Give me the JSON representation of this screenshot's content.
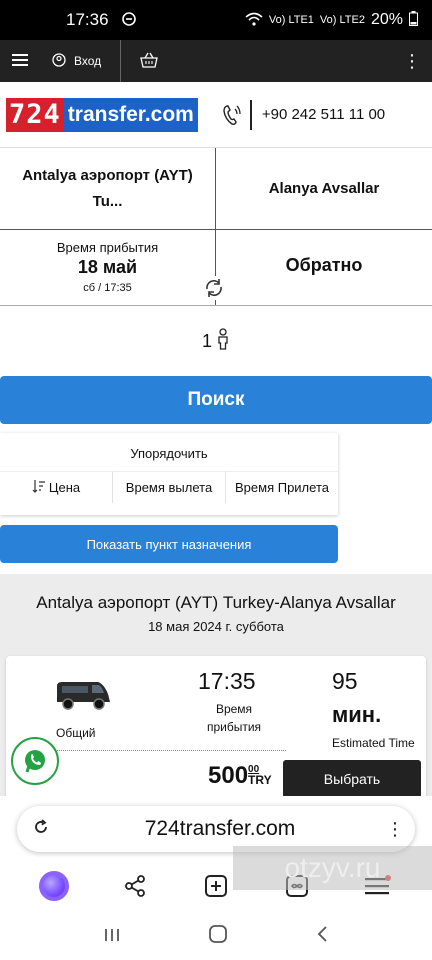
{
  "status_bar": {
    "time": "17:36",
    "network1": "Vo) LTE1",
    "network2": "Vo) LTE2",
    "battery": "20%"
  },
  "top_nav": {
    "login_label": "Вход"
  },
  "header": {
    "logo_number": "724",
    "logo_text": "transfer.com",
    "phone": "+90 242 511 11 00"
  },
  "route": {
    "from": "Antalya аэропорт (AYT) Tu...",
    "to": "Alanya Avsallar"
  },
  "dates": {
    "arrival_label": "Время прибытия",
    "arrival_date": "18 май",
    "arrival_sub": "сб / 17:35",
    "return_label": "Обратно"
  },
  "passengers": {
    "count": "1"
  },
  "search": {
    "button_label": "Поиск"
  },
  "sort": {
    "title": "Упорядочить",
    "options": [
      "Цена",
      "Время вылета",
      "Время Прилета"
    ]
  },
  "show_destination": {
    "label": "Показать пункт назначения"
  },
  "results": {
    "title": "Antalya аэропорт (AYT) Turkey-Alanya Avsallar",
    "date": "18 мая 2024 г. суббота",
    "card": {
      "vehicle_type": "Общий",
      "time": "17:35",
      "time_label": "Время прибытия",
      "duration": "95",
      "duration_unit": "мин.",
      "estimated_label": "Estimated Time",
      "price": "500",
      "price_cents": "00",
      "currency": "TRY",
      "choose_label": "Выбрать"
    }
  },
  "browser": {
    "url": "724transfer.com"
  },
  "watermark": {
    "text": "otzyv.ru"
  },
  "colors": {
    "primary": "#2a82d8",
    "logo_red": "#d6202b",
    "logo_blue": "#1c62c9",
    "whatsapp": "#25a244"
  }
}
